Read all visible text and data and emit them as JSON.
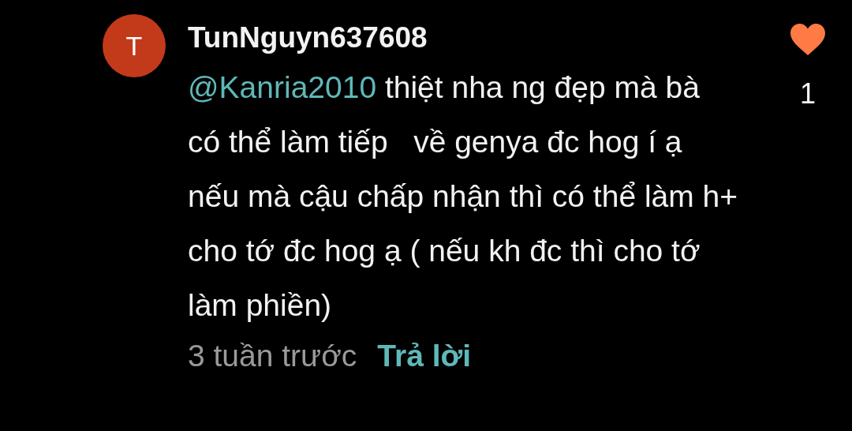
{
  "comment": {
    "avatar_letter": "T",
    "username": "TunNguyn637608",
    "mention": "@Kanria2010",
    "text": "thiệt nha ng đẹp mà bà có thể làm tiếp   về genya đc hog í ạ nếu mà cậu chấp nhận thì có thể làm h+ cho tớ đc hog ạ ( nếu kh đc thì cho tớ làm phiền)",
    "time": "3 tuần trước",
    "reply_label": "Trả lời",
    "liked": true,
    "like_count": "1"
  }
}
